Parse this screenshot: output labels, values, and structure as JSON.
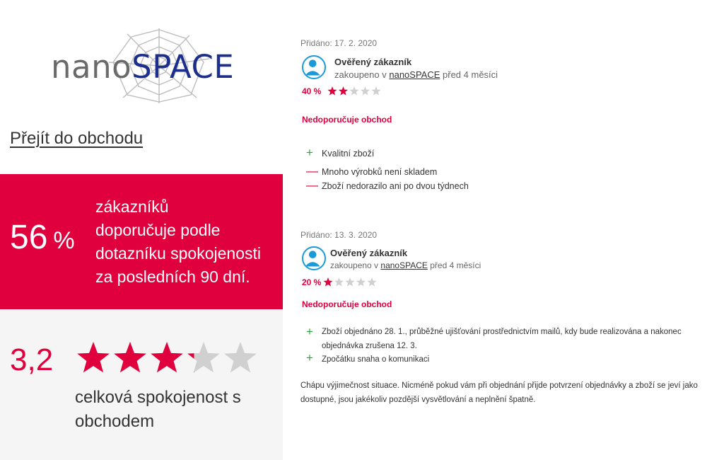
{
  "shop": {
    "logo_nano": "nano",
    "logo_space": "SPACE",
    "goto_label": "Přejít do obchodu"
  },
  "recommendation": {
    "percent": "56",
    "percent_sign": "%",
    "line1": "zákazníků",
    "line2": "doporučuje podle",
    "line3": "dotazníku spokojenosti",
    "line4": "za posledních 90 dní."
  },
  "satisfaction": {
    "score": "3,2",
    "stars_fraction": 0.64,
    "line1": "celková spokojenost s",
    "line2": "obchodem"
  },
  "reviews": [
    {
      "added": "Přidáno: 17. 2. 2020",
      "author": "Ověřený zákazník",
      "purchased_prefix": "zakoupeno v",
      "shop_name": "nanoSPACE",
      "purchased_suffix": "před 4 měsíci",
      "rating_percent": "40 %",
      "rating_fraction": 0.4,
      "verdict": "Nedoporučuje obchod",
      "pros": [
        "Kvalitní zboží"
      ],
      "cons": [
        "Mnoho výrobků není skladem",
        "Zboží nedorazilo ani po dvou týdnech"
      ],
      "comment": ""
    },
    {
      "added": "Přidáno: 13. 3. 2020",
      "author": "Ověřený zákazník",
      "purchased_prefix": "zakoupeno v",
      "shop_name": "nanoSPACE",
      "purchased_suffix": "před 4 měsíci",
      "rating_percent": "20 %",
      "rating_fraction": 0.2,
      "verdict": "Nedoporučuje obchod",
      "pros": [
        "Zboží objednáno 28. 1., průběžné ujišťování prostřednictvím mailů, kdy bude realizována a nakonec objednávka zrušena 12. 3.",
        "Zpočátku snaha o komunikaci"
      ],
      "cons": [],
      "comment": "Chápu výjimečnost situace. Nicméně pokud vám při objednání přijde potvrzení objednávky a zboží se jeví jako dostupné, jsou jakékoliv pozdější vysvětlování a neplnění špatně."
    }
  ],
  "icons": {
    "plus": "+",
    "minus": "—"
  },
  "colors": {
    "accent_red": "#e0003d",
    "pro_green": "#2ea43a",
    "avatar_blue": "#1a9bd7",
    "star_empty": "#d0d0d0",
    "logo_blue": "#1d2f8c"
  }
}
